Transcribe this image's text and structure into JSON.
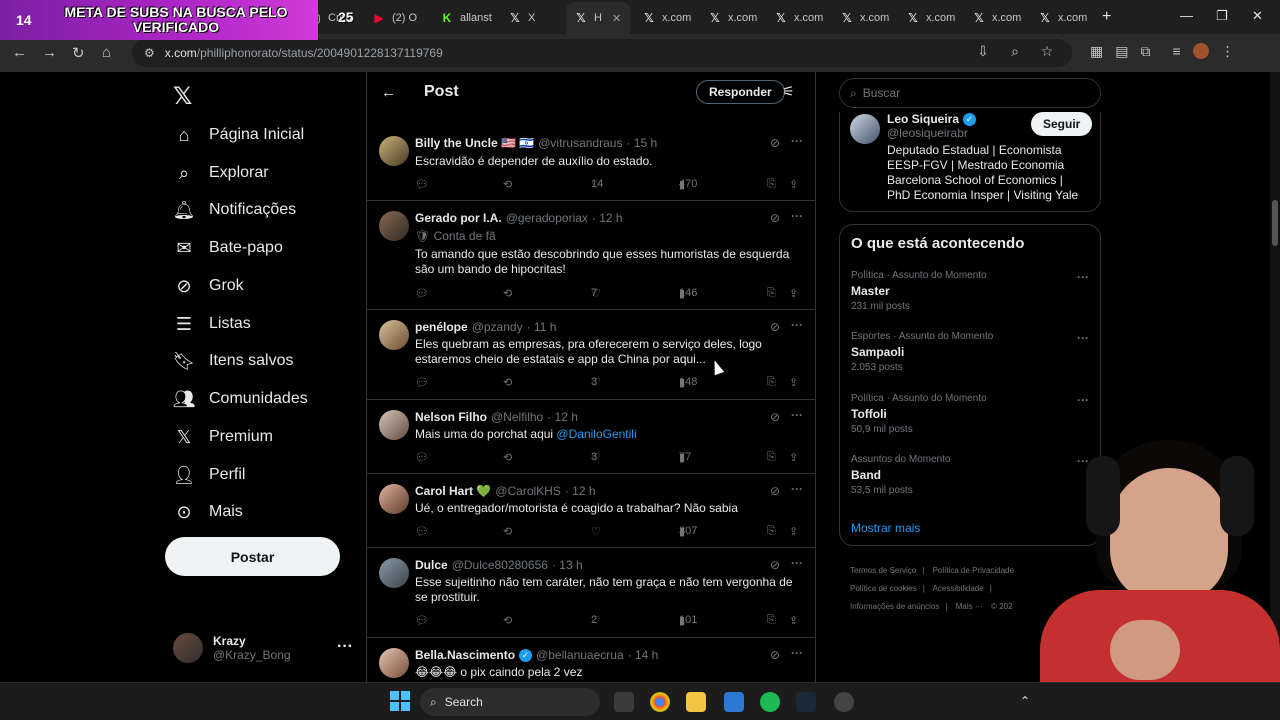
{
  "overlay": {
    "count_left": "14",
    "banner_text": "META DE SUBS NA BUSCA PELO VERIFICADO",
    "count_right": "25"
  },
  "browser": {
    "tabs": [
      {
        "label": "Crea",
        "icon": "tab-icon"
      },
      {
        "label": "(2) O",
        "icon": "youtube-icon"
      },
      {
        "label": "allanst",
        "icon": "kick-icon"
      },
      {
        "label": "X",
        "icon": "x-icon"
      },
      {
        "label": "H",
        "icon": "x-icon",
        "active": true
      },
      {
        "label": "x.com",
        "icon": "x-icon"
      },
      {
        "label": "x.com",
        "icon": "x-icon"
      },
      {
        "label": "x.com",
        "icon": "x-icon"
      },
      {
        "label": "x.com",
        "icon": "x-icon"
      },
      {
        "label": "x.com",
        "icon": "x-icon"
      },
      {
        "label": "x.com",
        "icon": "x-icon"
      },
      {
        "label": "x.com",
        "icon": "x-icon"
      }
    ],
    "url_host": "x.com",
    "url_path": "/philliphonorato/status/2004901228137119769"
  },
  "nav": {
    "items": [
      {
        "label": "Página Inicial",
        "icon": "home-icon"
      },
      {
        "label": "Explorar",
        "icon": "search-icon"
      },
      {
        "label": "Notificações",
        "icon": "bell-icon"
      },
      {
        "label": "Bate-papo",
        "icon": "mail-icon"
      },
      {
        "label": "Grok",
        "icon": "grok-icon"
      },
      {
        "label": "Listas",
        "icon": "list-icon"
      },
      {
        "label": "Itens salvos",
        "icon": "bookmark-icon"
      },
      {
        "label": "Comunidades",
        "icon": "people-icon"
      },
      {
        "label": "Premium",
        "icon": "x-icon"
      },
      {
        "label": "Perfil",
        "icon": "person-icon"
      },
      {
        "label": "Mais",
        "icon": "more-circle-icon"
      }
    ],
    "post_label": "Postar",
    "account": {
      "name": "Krazy",
      "handle": "@Krazy_Bong"
    }
  },
  "main": {
    "title": "Post",
    "reply_label": "Responder",
    "tweets": [
      {
        "name": "Billy the Uncle 🇺🇸 🇮🇱",
        "handle": "@vitrusandraus",
        "time": "· 15 h",
        "verified": false,
        "text": "Escravidão é depender de auxílio do estado.",
        "replies": "",
        "reposts": "",
        "likes": "14",
        "views": "470"
      },
      {
        "name": "Gerado por I.A.",
        "handle": "@geradoporiax",
        "time": "· 12 h",
        "verified": false,
        "fan": "Conta de fã",
        "text": "To amando que estão descobrindo que esses humoristas de esquerda são um bando de hipocritas!",
        "replies": "",
        "reposts": "",
        "likes": "7",
        "views": "146"
      },
      {
        "name": "penélope",
        "handle": "@pzandy",
        "time": "· 11 h",
        "verified": false,
        "text": "Eles quebram as empresas, pra oferecerem o serviço deles, logo estaremos cheio de estatais e app da China por aqui...",
        "replies": "",
        "reposts": "",
        "likes": "3",
        "views": "148"
      },
      {
        "name": "Nelson Filho",
        "handle": "@Nelfilho",
        "time": "· 12 h",
        "verified": false,
        "text": "Mais uma do porchat aqui ",
        "mention": "@DaniloGentili",
        "replies": "",
        "reposts": "",
        "likes": "3",
        "views": "77"
      },
      {
        "name": "Carol Hart 💚",
        "handle": "@CarolKHS",
        "time": "· 12 h",
        "verified": false,
        "text": "Ué, o entregador/motorista é coagido a trabalhar? Não sabia",
        "replies": "",
        "reposts": "",
        "likes": "",
        "views": "307"
      },
      {
        "name": "Dulce",
        "handle": "@Dulce80280656",
        "time": "· 13 h",
        "verified": false,
        "text": "Esse sujeitinho não tem caráter, não tem graça e não tem vergonha de se prostituir.",
        "replies": "",
        "reposts": "",
        "likes": "2",
        "views": "101"
      },
      {
        "name": "Bella.Nascimento",
        "handle": "@bellanuaecrua",
        "time": "· 14 h",
        "verified": true,
        "text": "😂😂😂 o pix caindo pela 2 vez",
        "replies": "",
        "reposts": "",
        "likes": "",
        "views": ""
      }
    ]
  },
  "right": {
    "search_placeholder": "Buscar",
    "profile": {
      "name": "Leo Siqueira",
      "handle": "@leosiqueirabr",
      "bio": "Deputado Estadual | Economista EESP-FGV | Mestrado Economia Barcelona School of Economics | PhD Economia Insper | Visiting Yale",
      "follow_label": "Seguir"
    },
    "trends_title": "O que está acontecendo",
    "trends": [
      {
        "category": "Política · Assunto do Momento",
        "topic": "Master",
        "count": "231 mil posts"
      },
      {
        "category": "Esportes · Assunto do Momento",
        "topic": "Sampaoli",
        "count": "2.053 posts"
      },
      {
        "category": "Política · Assunto do Momento",
        "topic": "Toffoli",
        "count": "50,9 mil posts"
      },
      {
        "category": "Assuntos do Momento",
        "topic": "Band",
        "count": "53,5 mil posts"
      }
    ],
    "show_more": "Mostrar mais",
    "footer": [
      "Termos de Serviço",
      "|",
      "Política de Privacidade",
      "|",
      "Política de cookies",
      "|",
      "Acessibilidade",
      "|",
      "Informações de anúncios",
      "|",
      "Mais ···",
      "© 202"
    ]
  },
  "taskbar": {
    "search_label": "Search"
  },
  "colors": {
    "accent": "#1d9bf0",
    "banner": "#b026c9",
    "background": "#000000"
  }
}
